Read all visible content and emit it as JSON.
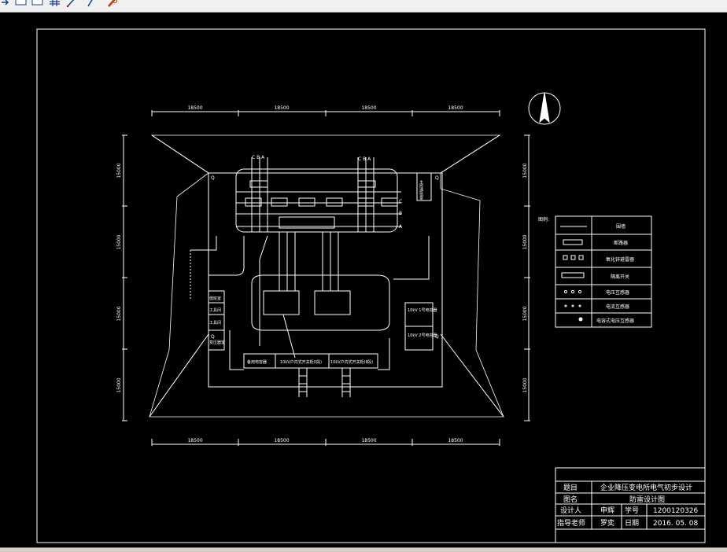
{
  "toolbar": {
    "buttons": [
      {
        "icon": "arrow-icon"
      },
      {
        "icon": "rectangle-icon"
      },
      {
        "icon": "rectangle-icon"
      },
      {
        "icon": "grid-icon"
      },
      {
        "icon": "pen-icon"
      },
      {
        "icon": "pen-icon"
      },
      {
        "icon": "wrench-icon"
      }
    ]
  },
  "drawing": {
    "dims_top": [
      "18500",
      "18500",
      "18500",
      "18500"
    ],
    "dims_bottom": [
      "18500",
      "18500",
      "18500",
      "18500"
    ],
    "dims_left": [
      "15000",
      "15000",
      "15000",
      "15000"
    ],
    "dims_right": [
      "15000",
      "15000",
      "15000",
      "15000"
    ],
    "phase_labels_left": "C B A",
    "phase_labels_right": "C B A",
    "bus_labels": [
      "C",
      "B",
      "A"
    ],
    "room_labels": {
      "right_top": "主控通信室",
      "left_a": "值班室",
      "left_b": "工具间",
      "left_c": "工具间",
      "left_d": "变压器室",
      "bottom_a": "备用电容器",
      "bottom_b": "10kV户内式开关柜(Ⅰ段)",
      "bottom_c": "10kV户内式开关柜(Ⅱ段)",
      "tr1": "10kV\n1号电容器",
      "tr2": "10kV\n2号电容器"
    },
    "lightning_mark": "Q"
  },
  "legend": {
    "title": "图例:",
    "items": [
      {
        "symbol": "fence",
        "label": "围墙"
      },
      {
        "symbol": "breaker",
        "label": "断路器"
      },
      {
        "symbol": "surge",
        "label": "氧化锌避雷器"
      },
      {
        "symbol": "isolator",
        "label": "隔离开关"
      },
      {
        "symbol": "vt",
        "label": "电压互感器"
      },
      {
        "symbol": "ct",
        "label": "电流互感器"
      },
      {
        "symbol": "cvt",
        "label": "电容式电压互感器"
      }
    ]
  },
  "titleblock": {
    "rows": [
      [
        "题目",
        "企业降压变电所电气初步设计"
      ],
      [
        "图名",
        "防雷设计图"
      ]
    ],
    "designer_label": "设计人",
    "designer_name": "申辉",
    "student_id_label": "学号",
    "student_id": "1200120326",
    "advisor_label": "指导老师",
    "advisor_name": "罗奕",
    "date_label": "日期",
    "date": "2016. 05. 08"
  },
  "colors": {
    "background": "#000000",
    "line": "#ffffff"
  }
}
